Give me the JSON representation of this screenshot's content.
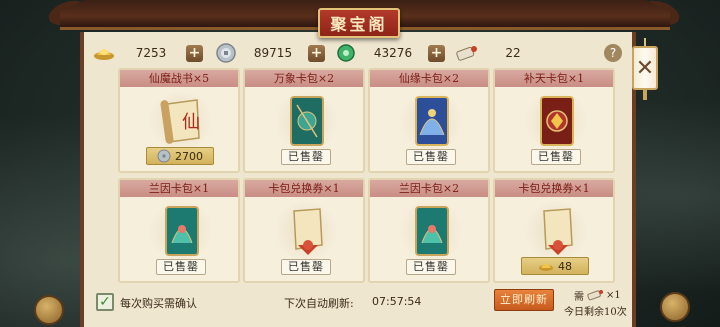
{
  "title": "聚宝阁",
  "resources": [
    {
      "icon": "gold-ingot-icon",
      "value": "7253"
    },
    {
      "icon": "silver-coin-icon",
      "value": "89715"
    },
    {
      "icon": "jade-icon",
      "value": "43276"
    },
    {
      "icon": "scroll-ticket-icon",
      "value": "22"
    }
  ],
  "help_label": "?",
  "cards": [
    {
      "name": "仙魔战书×5",
      "status": "price",
      "price_icon": "silver-coin-icon",
      "price": "2700",
      "art": "war-scroll-icon"
    },
    {
      "name": "万象卡包×2",
      "status": "sold",
      "sold_label": "已售罄",
      "art": "card-pack-teal-icon"
    },
    {
      "name": "仙缘卡包×2",
      "status": "sold",
      "sold_label": "已售罄",
      "art": "card-pack-blue-icon"
    },
    {
      "name": "补天卡包×1",
      "status": "sold",
      "sold_label": "已售罄",
      "art": "card-pack-red-icon"
    },
    {
      "name": "兰因卡包×1",
      "status": "sold",
      "sold_label": "已售罄",
      "art": "card-pack-teal-icon"
    },
    {
      "name": "卡包兑换券×1",
      "status": "sold",
      "sold_label": "已售罄",
      "art": "voucher-scroll-icon"
    },
    {
      "name": "兰因卡包×2",
      "status": "sold",
      "sold_label": "已售罄",
      "art": "card-pack-teal-icon"
    },
    {
      "name": "卡包兑换券×1",
      "status": "price",
      "price_icon": "gold-ingot-icon",
      "price": "48",
      "art": "voucher-scroll-icon"
    }
  ],
  "footer": {
    "confirm_label": "每次购买需确认",
    "confirm_checked": true,
    "refresh_label": "下次自动刷新:",
    "refresh_time": "07:57:54",
    "refresh_button": "立即刷新",
    "need_prefix": "需",
    "need_suffix": "×1",
    "remain": "今日剩余10次"
  },
  "colors": {
    "panel": "#efe6cf",
    "card_head": "#c98d84",
    "refresh_button": "#d86a2a",
    "title_plaque": "#a5301f"
  }
}
